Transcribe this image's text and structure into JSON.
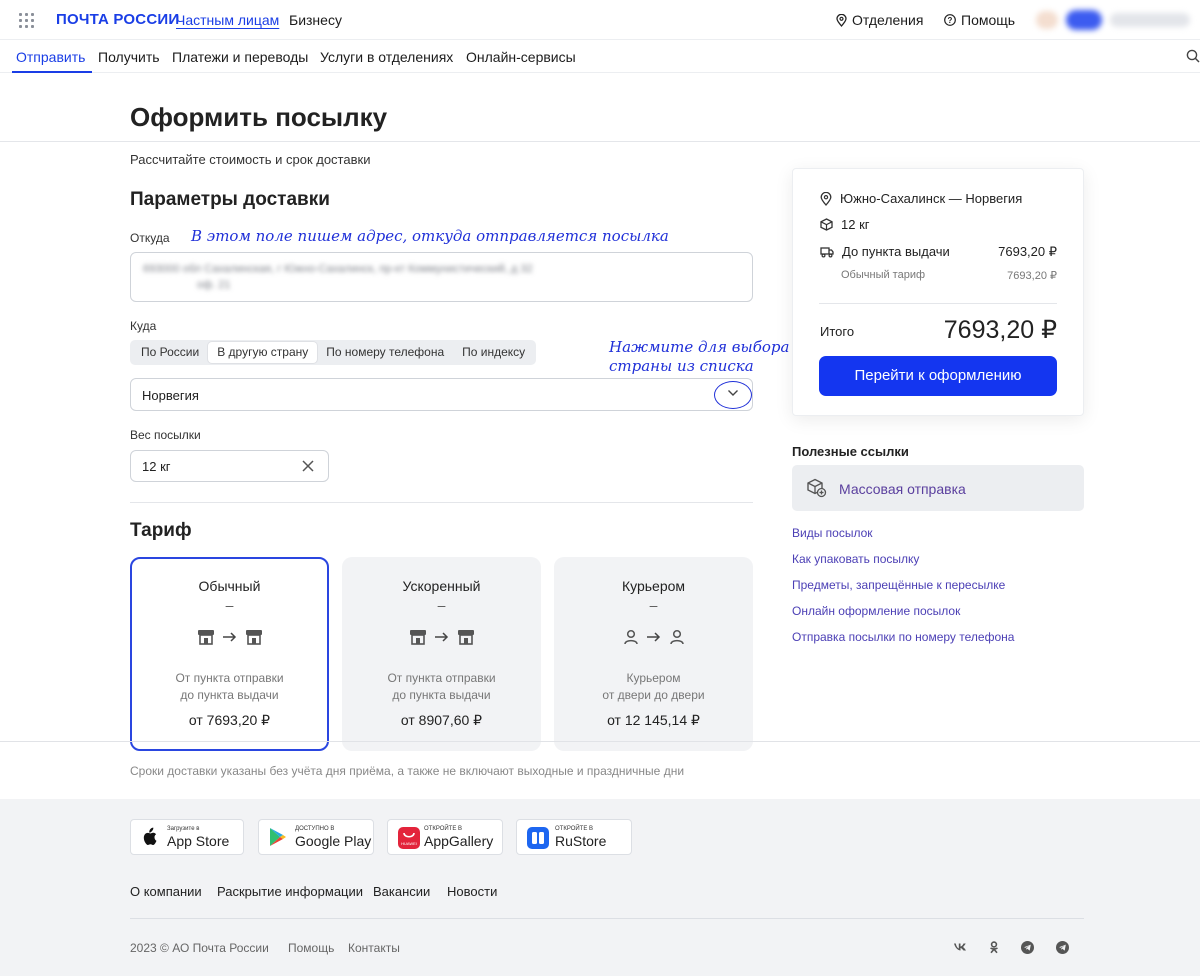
{
  "header": {
    "logo": "ПОЧТА РОССИИ",
    "segment_private": "Частным лицам",
    "segment_business": "Бизнесу",
    "offices": "Отделения",
    "help": "Помощь"
  },
  "nav": {
    "items": [
      "Отправить",
      "Получить",
      "Платежи и переводы",
      "Услуги в отделениях",
      "Онлайн-сервисы"
    ],
    "active": "Отправить"
  },
  "page": {
    "title": "Оформить посылку",
    "subtitle": "Рассчитайте стоимость и срок доставки"
  },
  "params": {
    "heading": "Параметры доставки",
    "from_label": "Откуда",
    "from_note": "В этом поле пишем адрес, откуда отправляется посылка",
    "from_value_line1": "693000 обл Сахалинская, г Южно-Сахалинск, пр-кт Коммунистический, д 32",
    "from_value_line2": "оф. 21",
    "to_label": "Куда",
    "to_modes": [
      "По России",
      "В другую страну",
      "По номеру телефона",
      "По индексу"
    ],
    "to_mode_selected": "В другую страну",
    "country_note_line1": "Нажмите для выбора",
    "country_note_line2": "страны из списка",
    "country_value": "Норвегия",
    "weight_label": "Вес посылки",
    "weight_value": "12 кг"
  },
  "tariff": {
    "heading": "Тариф",
    "options": [
      {
        "name": "Обычный",
        "dash": "–",
        "desc1": "От пункта отправки",
        "desc2": "до пункта выдачи",
        "price": "от 7693,20 ₽",
        "icon": "office-to-office",
        "selected": true
      },
      {
        "name": "Ускоренный",
        "dash": "–",
        "desc1": "От пункта отправки",
        "desc2": "до пункта выдачи",
        "price": "от 8907,60 ₽",
        "icon": "office-to-office",
        "selected": false
      },
      {
        "name": "Курьером",
        "dash": "–",
        "desc1": "Курьером",
        "desc2": "от двери до двери",
        "price": "от 12 145,14 ₽",
        "icon": "person-to-person",
        "selected": false
      }
    ],
    "disclaimer": "Сроки доставки указаны без учёта дня приёма, а также не включают выходные и праздничные дни"
  },
  "summary": {
    "route": "Южно-Сахалинск — Норвегия",
    "weight": "12 кг",
    "delivery_label": "До пункта выдачи",
    "delivery_price": "7693,20 ₽",
    "tariff_label": "Обычный тариф",
    "tariff_price": "7693,20 ₽",
    "total_label": "Итого",
    "total_value": "7693,20 ₽",
    "button": "Перейти к оформлению"
  },
  "useful": {
    "heading": "Полезные ссылки",
    "mass_send": "Массовая отправка",
    "links": [
      "Виды посылок",
      "Как упаковать посылку",
      "Предметы, запрещённые к пересылке",
      "Онлайн оформление посылок",
      "Отправка посылки по номеру телефона"
    ]
  },
  "footer": {
    "stores": [
      {
        "small": "Загрузите в",
        "big": "App Store",
        "icon": "apple-icon"
      },
      {
        "small": "ДОСТУПНО В",
        "big": "Google Play",
        "icon": "google-play-icon"
      },
      {
        "small": "ОТКРОЙТЕ В",
        "big": "AppGallery",
        "icon": "huawei-icon"
      },
      {
        "small": "ОТКРОЙТЕ В",
        "big": "RuStore",
        "icon": "rustore-icon"
      }
    ],
    "links": [
      "О компании",
      "Раскрытие информации",
      "Вакансии",
      "Новости"
    ],
    "copyright": "2023 © АО Почта России",
    "help": "Помощь",
    "contacts": "Контакты",
    "social": [
      "vk-icon",
      "ok-icon",
      "telegram-icon",
      "telegram-icon"
    ]
  },
  "colors": {
    "accent": "#1436f0",
    "note": "#2030d8",
    "link": "#4b3fb5"
  }
}
